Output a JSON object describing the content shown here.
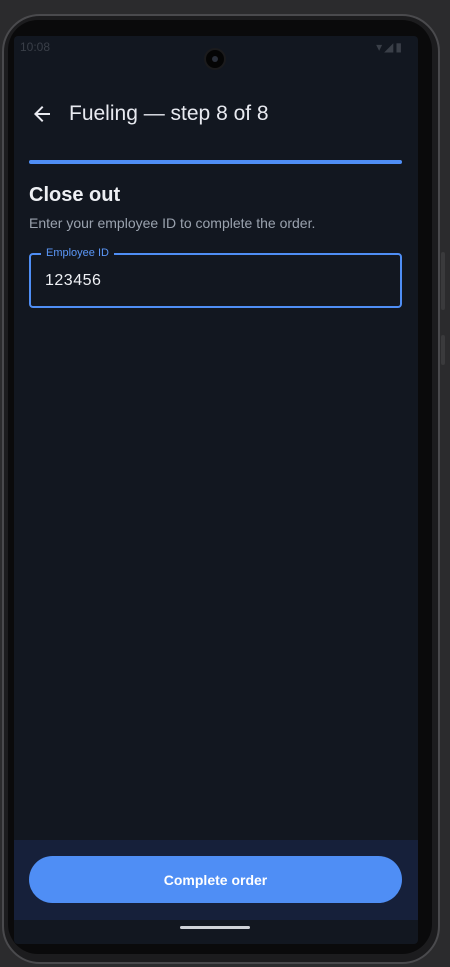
{
  "status_bar": {
    "time": "10:08",
    "icons": "▾◢▮"
  },
  "app_bar": {
    "back_icon": "arrow-back-icon",
    "title": "Fueling — step 8 of 8"
  },
  "progress": {
    "current_step": 8,
    "total_steps": 8,
    "fraction": 1.0
  },
  "content": {
    "title": "Close out",
    "subtitle": "Enter your employee ID to complete the order."
  },
  "employee_field": {
    "label": "Employee ID",
    "value": "123456"
  },
  "footer": {
    "button_label": "Complete order"
  },
  "colors": {
    "accent": "#4f8ef5",
    "background": "#121720",
    "bottom_panel": "#16203a",
    "text_primary": "#eef0f4",
    "text_secondary": "#9aa2ae"
  }
}
